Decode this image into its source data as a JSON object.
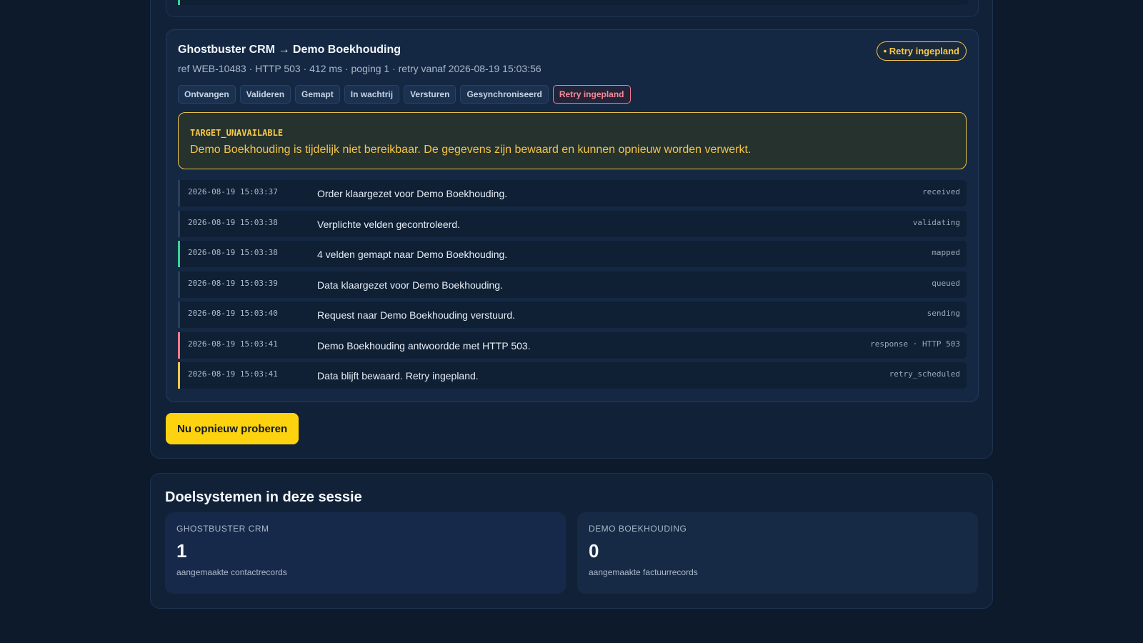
{
  "sync_entry": {
    "title": "Ghostbuster CRM → Demo Boekhouding",
    "meta": "ref WEB-10483 · HTTP 503 · 412 ms · poging 1 · retry vanaf 2026-08-19 15:03:56",
    "status": "• Retry ingepland",
    "steps": [
      {
        "label": "Ontvangen"
      },
      {
        "label": "Valideren"
      },
      {
        "label": "Gemapt"
      },
      {
        "label": "In wachtrij"
      },
      {
        "label": "Versturen"
      },
      {
        "label": "Gesynchroniseerd"
      },
      {
        "label": "Retry ingepland"
      }
    ],
    "error": {
      "code": "TARGET_UNAVAILABLE",
      "message": "Demo Boekhouding is tijdelijk niet bereikbaar. De gegevens zijn bewaard en kunnen opnieuw worden verwerkt."
    },
    "log": [
      {
        "time": "2026-08-19 15:03:37",
        "message": "Order klaargezet voor Demo Boekhouding.",
        "type": "received"
      },
      {
        "time": "2026-08-19 15:03:38",
        "message": "Verplichte velden gecontroleerd.",
        "type": "validating"
      },
      {
        "time": "2026-08-19 15:03:38",
        "message": "4 velden gemapt naar Demo Boekhouding.",
        "type": "mapped"
      },
      {
        "time": "2026-08-19 15:03:39",
        "message": "Data klaargezet voor Demo Boekhouding.",
        "type": "queued"
      },
      {
        "time": "2026-08-19 15:03:40",
        "message": "Request naar Demo Boekhouding verstuurd.",
        "type": "sending"
      },
      {
        "time": "2026-08-19 15:03:41",
        "message": "Demo Boekhouding antwoordde met HTTP 503.",
        "type": "response · HTTP 503"
      },
      {
        "time": "2026-08-19 15:03:41",
        "message": "Data blijft bewaard. Retry ingepland.",
        "type": "retry_scheduled"
      }
    ]
  },
  "retry_button": {
    "label": "Nu opnieuw proberen"
  },
  "targets": {
    "title": "Doelsystemen in deze sessie",
    "items": [
      {
        "name": "Ghostbuster CRM",
        "count": "1",
        "description": "aangemaakte contactrecords"
      },
      {
        "name": "Demo Boekhouding",
        "count": "0",
        "description": "aangemaakte factuurrecords"
      }
    ]
  },
  "colors": {
    "background": "#0c1a2c",
    "accent_yellow": "#fdd20f",
    "warning": "#f5c84c",
    "error": "#f27b8a",
    "success": "#34d399"
  }
}
